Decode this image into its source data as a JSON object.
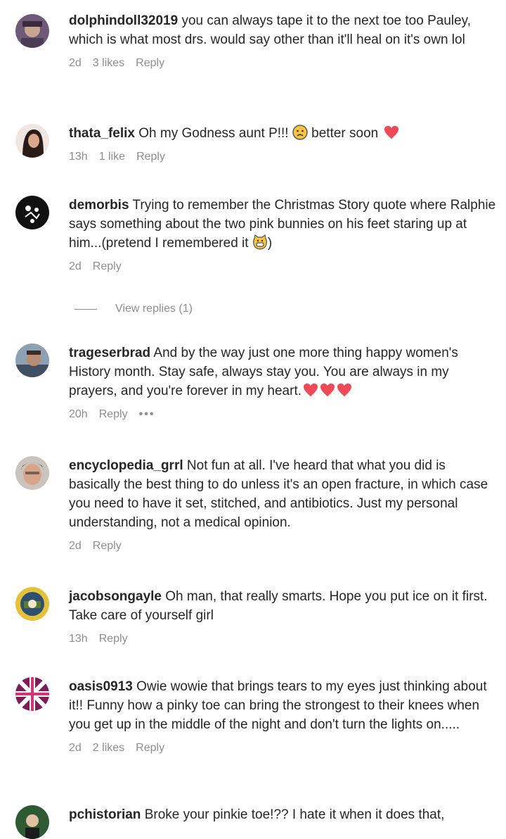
{
  "comments": [
    {
      "username": "dolphindoll32019",
      "text": "you can always tape it to the next toe too Pauley, which is what most drs. would say other than it'll heal on it's own lol",
      "time": "2d",
      "likes": "3 likes",
      "reply": "Reply"
    },
    {
      "username": "thata_felix",
      "text": "Oh my Godness aunt P!!!",
      "text_after": "better soon",
      "time": "13h",
      "likes": "1 like",
      "reply": "Reply"
    },
    {
      "username": "demorbis",
      "text": "Trying to remember the Christmas Story quote where Ralphie says something about the two pink bunnies on his feet staring up at him...(pretend I remembered it",
      "text_after": ")",
      "time": "2d",
      "reply": "Reply",
      "view_replies": "View replies (1)"
    },
    {
      "username": "trageserbrad",
      "text": "And by the way just one more thing happy women's History month. Stay safe, always stay you. You are always in my prayers, and you're forever in my heart.",
      "time": "20h",
      "reply": "Reply",
      "more": "•••"
    },
    {
      "username": "encyclopedia_grrl",
      "text": "Not fun at all. I've heard that what you did is basically the best thing to do unless it's an open fracture, in which case you need to have it set, stitched, and antibiotics. Just my personal understanding, not a medical opinion.",
      "time": "2d",
      "reply": "Reply"
    },
    {
      "username": "jacobsongayle",
      "text": "Oh man, that really smarts. Hope you put ice on it first. Take care of yourself girl",
      "time": "13h",
      "reply": "Reply"
    },
    {
      "username": "oasis0913",
      "text": "Owie wowie that brings tears to my eyes just thinking about it!! Funny how a pinky toe can bring the strongest to their knees when you get up in the middle of the night and don't turn the lights on.....",
      "time": "2d",
      "likes": "2 likes",
      "reply": "Reply"
    },
    {
      "username": "pchistorian",
      "text": "Broke your pinkie toe!?? I hate it when it does that,"
    }
  ],
  "colors": {
    "text": "#262626",
    "meta": "#8e8e8e",
    "heart": "#ed4956"
  },
  "icons": [
    "avatar",
    "heart-icon",
    "worried-face-emoji",
    "grinning-cat-emoji"
  ]
}
